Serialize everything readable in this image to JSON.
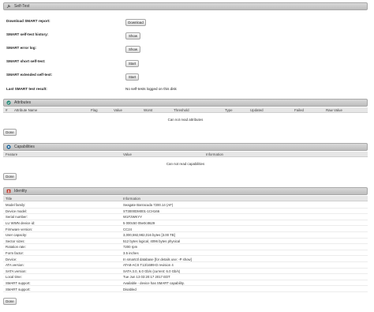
{
  "self_test": {
    "title": "Self-Test",
    "rows": [
      {
        "label": "Download SMART report:",
        "button": "Download"
      },
      {
        "label": "SMART self-test history:",
        "button": "Show"
      },
      {
        "label": "SMART error log:",
        "button": "Show"
      },
      {
        "label": "SMART short self-test:",
        "button": "Start"
      },
      {
        "label": "SMART extended self-test:",
        "button": "Start"
      }
    ],
    "last_result_label": "Last SMART test result:",
    "last_result_value": "No self-tests logged on this disk"
  },
  "attributes": {
    "title": "Attributes",
    "columns": [
      "#",
      "Attribute Name",
      "Flag",
      "Value",
      "Worst",
      "Threshold",
      "Type",
      "Updated",
      "Failed",
      "Raw Value"
    ],
    "empty_message": "Can not read attributes",
    "done_button": "Done"
  },
  "capabilities": {
    "title": "Capabilities",
    "columns": [
      "Feature",
      "Value",
      "Information"
    ],
    "empty_message": "Can not read capabilities",
    "done_button": "Done"
  },
  "identity": {
    "title": "Identity",
    "columns": [
      "Title",
      "Information"
    ],
    "rows": [
      {
        "k": "Model family:",
        "v": "Seagate Barracuda 7200.14 (AF)"
      },
      {
        "k": "Device model:",
        "v": "ST3000DM001-1CH166"
      },
      {
        "k": "Serial number:",
        "v": "W1F2WKYY"
      },
      {
        "k": "LU WWN device id:",
        "v": "5 000c50 05e0c8629"
      },
      {
        "k": "Firmware version:",
        "v": "CC24"
      },
      {
        "k": "User capacity:",
        "v": "3,000,592,982,016 bytes [3.00 TB]"
      },
      {
        "k": "Sector sizes:",
        "v": "512 bytes logical, 4096 bytes physical"
      },
      {
        "k": "Rotation rate:",
        "v": "7200 rpm"
      },
      {
        "k": "Form factor:",
        "v": "3.5 inches"
      },
      {
        "k": "Device:",
        "v": "In smartctl database [for details use: -P show]"
      },
      {
        "k": "ATA version:",
        "v": "ATA8-ACS T13/1699-D revision 4"
      },
      {
        "k": "SATA version:",
        "v": "SATA 3.0, 6.0 Gb/s (current: 6.0 Gb/s)"
      },
      {
        "k": "Local time:",
        "v": "Tue Jun 13 03:20:17 2017 EDT"
      },
      {
        "k": "SMART support:",
        "v": "Available - device has SMART capability."
      },
      {
        "k": "SMART support:",
        "v": "Disabled"
      }
    ],
    "done_button": "Done"
  },
  "colors": {
    "header_bg": "#c8c8c8",
    "attributes_icon": "#2a8c7a",
    "capabilities_icon": "#2a6ea0",
    "identity_icon": "#c0392b"
  }
}
